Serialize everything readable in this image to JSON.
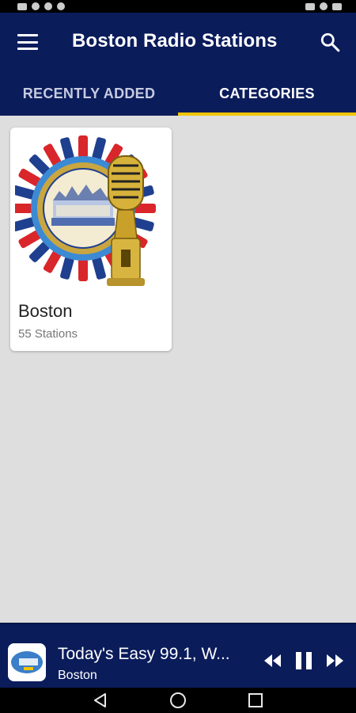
{
  "app": {
    "title": "Boston Radio Stations",
    "accent": "#f1c400",
    "bar_color": "#0b1c5b"
  },
  "tabs": [
    {
      "label": "RECENTLY ADDED",
      "active": false
    },
    {
      "label": "CATEGORIES",
      "active": true
    }
  ],
  "categories": [
    {
      "name": "Boston",
      "count_label": "55 Stations",
      "image": "boston-seal-microphone"
    }
  ],
  "player": {
    "title": "Today's Easy 99.1, W...",
    "subtitle": "Boston",
    "state": "playing"
  },
  "icons": {
    "menu": "menu-icon",
    "search": "search-icon",
    "rewind": "rewind-icon",
    "pause": "pause-icon",
    "forward": "fast-forward-icon",
    "back": "nav-back-icon",
    "home": "nav-home-icon",
    "recents": "nav-recents-icon"
  }
}
